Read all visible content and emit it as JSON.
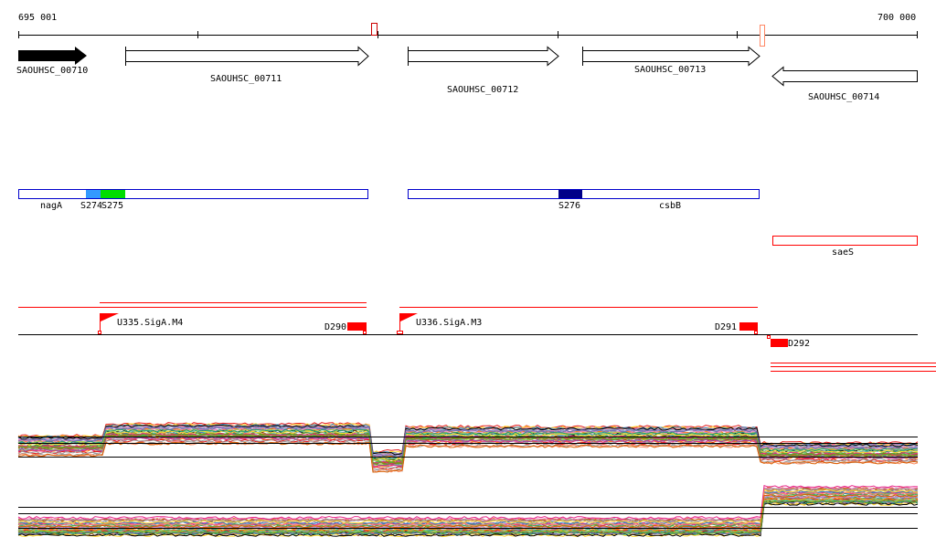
{
  "ruler": {
    "start_label": "695 001",
    "end_label": "700 000"
  },
  "genes": [
    {
      "name": "SAOUHSC_00710",
      "strand": "+",
      "filled": true
    },
    {
      "name": "SAOUHSC_00711",
      "strand": "+",
      "filled": false
    },
    {
      "name": "SAOUHSC_00712",
      "strand": "+",
      "filled": false
    },
    {
      "name": "SAOUHSC_00713",
      "strand": "+",
      "filled": false
    },
    {
      "name": "SAOUHSC_00714",
      "strand": "-",
      "filled": false
    }
  ],
  "operons": {
    "nagA": "nagA",
    "s274": "S274",
    "s275": "S275",
    "s276": "S276",
    "csbB": "csbB",
    "saeS": "saeS"
  },
  "promoters": {
    "u335": "U335.SigA.M4",
    "u336": "U336.SigA.M3",
    "d290": "D290",
    "d291": "D291",
    "d292": "D292"
  },
  "colors": {
    "operon_outline": "#0000cc",
    "s274": "#3399ff",
    "s275": "#00dd00",
    "s276": "#000088",
    "feature_red": "#ff0000",
    "expression_palette": [
      "#e41a1c",
      "#377eb8",
      "#4daf4a",
      "#984ea3",
      "#ff7f00",
      "#a65628",
      "#f781bf",
      "#999999",
      "#66c2a5",
      "#fc8d62",
      "#8da0cb",
      "#e78ac3",
      "#a6d854",
      "#ffd92f",
      "#000000",
      "#1b9e77",
      "#d95f02",
      "#7570b3",
      "#e7298a",
      "#66a61e"
    ]
  }
}
